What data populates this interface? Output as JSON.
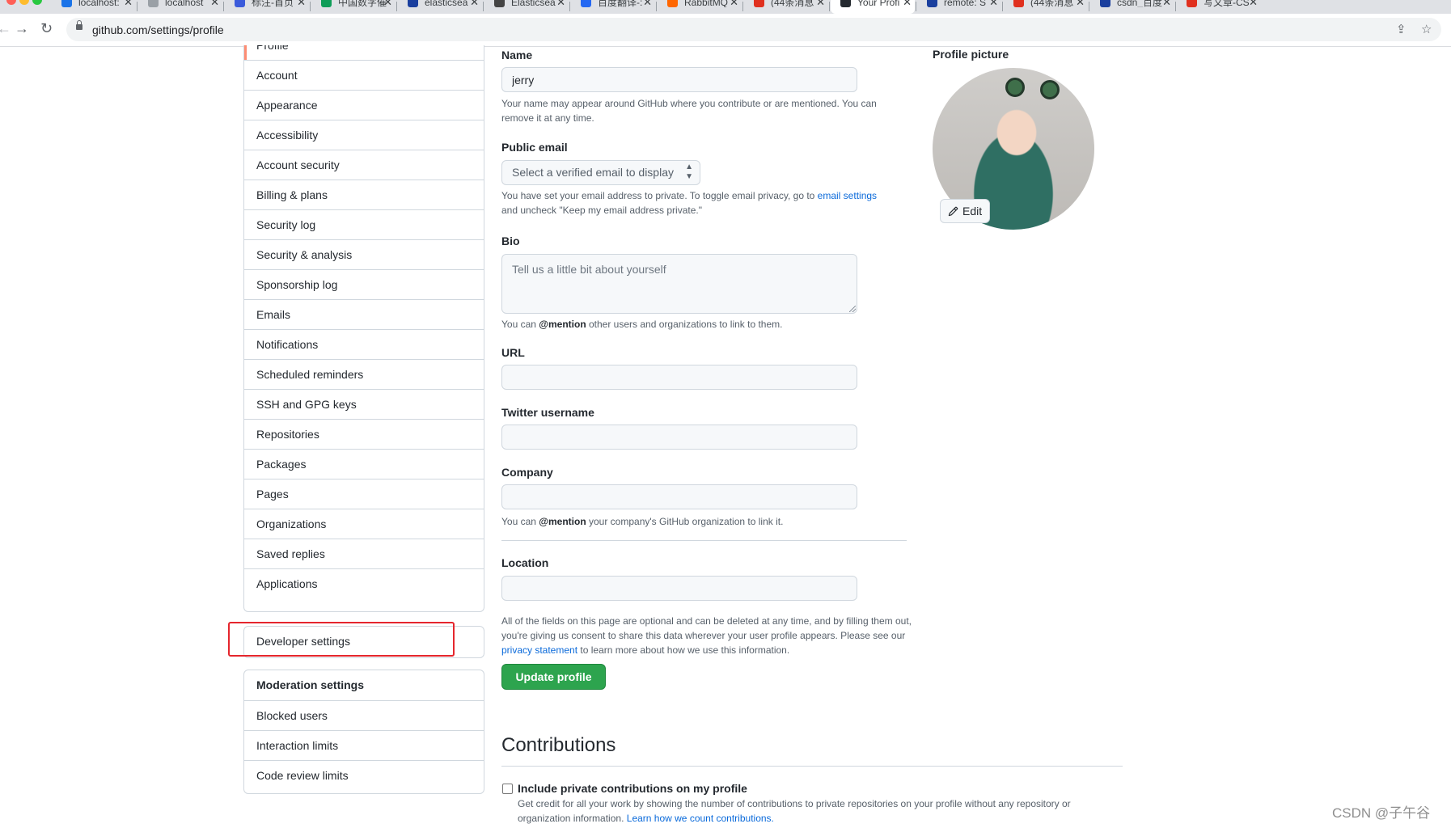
{
  "browser": {
    "tabs": [
      {
        "label": "localhost:",
        "color": "#1a73e8"
      },
      {
        "label": "localhost",
        "color": "#9aa0a6"
      },
      {
        "label": "标注-首页",
        "color": "#3b5bdb"
      },
      {
        "label": "中国数字催",
        "color": "#0f9d58"
      },
      {
        "label": "elasticsea",
        "color": "#1a3f9e"
      },
      {
        "label": "Elasticsea",
        "color": "#444444"
      },
      {
        "label": "百度翻译-:",
        "color": "#2468f2"
      },
      {
        "label": "RabbitMQ",
        "color": "#ff6600"
      },
      {
        "label": "(44条消息",
        "color": "#e0301e"
      },
      {
        "label": "Your Profi",
        "color": "#24292f"
      },
      {
        "label": "remote: S",
        "color": "#1a3f9e"
      },
      {
        "label": "(44条消息",
        "color": "#e0301e"
      },
      {
        "label": "csdn_百度",
        "color": "#1a3f9e"
      },
      {
        "label": "写文章-CS",
        "color": "#e0301e"
      }
    ],
    "url": "github.com/settings/profile"
  },
  "sidebar": {
    "top_partial": "Profile",
    "main_items": [
      "Account",
      "Appearance",
      "Accessibility",
      "Account security",
      "Billing & plans",
      "Security log",
      "Security & analysis",
      "Sponsorship log",
      "Emails",
      "Notifications",
      "Scheduled reminders",
      "SSH and GPG keys",
      "Repositories",
      "Packages",
      "Pages",
      "Organizations",
      "Saved replies",
      "Applications"
    ],
    "developer": "Developer settings",
    "moderation": [
      "Moderation settings",
      "Blocked users",
      "Interaction limits",
      "Code review limits"
    ]
  },
  "form": {
    "name_label": "Name",
    "name_value": "jerry",
    "name_note": "Your name may appear around GitHub where you contribute or are mentioned. You can remove it at any time.",
    "email_label": "Public email",
    "email_select": "Select a verified email to display",
    "email_note_prefix": "You have set your email address to private. To toggle email privacy, go to",
    "email_note_link": "email settings",
    "email_note_suffix": "and uncheck \"Keep my email address private.\"",
    "bio_label": "Bio",
    "bio_placeholder": "Tell us a little bit about yourself",
    "bio_note_prefix": "You can",
    "mention": "@mention",
    "bio_note_suffix": "other users and organizations to link to them.",
    "url_label": "URL",
    "twitter_label": "Twitter username",
    "company_label": "Company",
    "company_note_suffix": "your company's GitHub organization to link it.",
    "location_label": "Location",
    "optional_note_prefix": "All of the fields on this page are optional and can be deleted at any time, and by filling them out, you're giving us consent to share this data wherever your user profile appears. Please see our",
    "privacy_link": "privacy statement",
    "optional_note_suffix": "to learn more about how we use this information.",
    "update_button": "Update profile"
  },
  "contributions": {
    "heading": "Contributions",
    "checkbox_label": "Include private contributions on my profile",
    "desc": "Get credit for all your work by showing the number of contributions to private repositories on your profile without any repository or organization information.",
    "learn_link": "Learn how we count contributions."
  },
  "profile_picture": {
    "label": "Profile picture",
    "edit_button": "Edit"
  },
  "watermark": "CSDN @子午谷"
}
